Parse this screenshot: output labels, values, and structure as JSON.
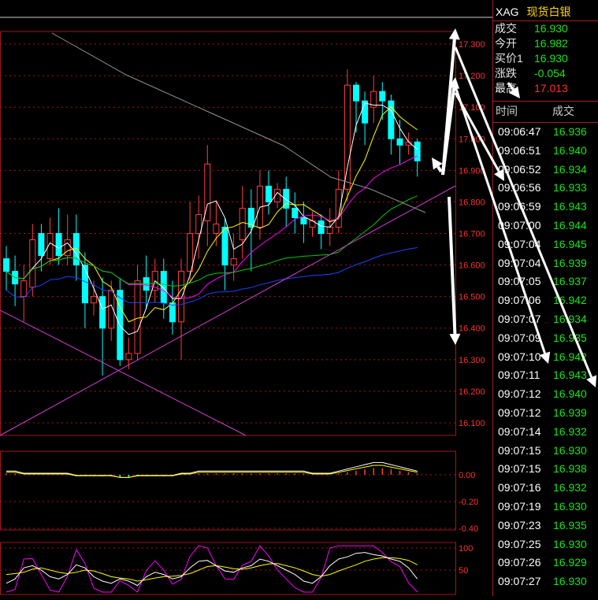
{
  "symbol": {
    "code": "XAG",
    "name": "现货白银"
  },
  "quote": [
    {
      "label": "成交",
      "value": "16.930",
      "color": "green"
    },
    {
      "label": "今开",
      "value": "16.982",
      "color": "green"
    },
    {
      "label": "买价1",
      "value": "16.930",
      "color": "green"
    },
    {
      "label": "涨跌",
      "value": "-0.054",
      "color": "green"
    },
    {
      "label": "最高",
      "value": "17.013",
      "color": "red"
    }
  ],
  "ticks_header": {
    "time": "时间",
    "price": "成交"
  },
  "ticks": [
    {
      "time": "09:06:47",
      "price": "16.936"
    },
    {
      "time": "09:06:51",
      "price": "16.940"
    },
    {
      "time": "09:06:52",
      "price": "16.934"
    },
    {
      "time": "09:06:56",
      "price": "16.933"
    },
    {
      "time": "09:06:59",
      "price": "16.943"
    },
    {
      "time": "09:07:00",
      "price": "16.944"
    },
    {
      "time": "09:07:04",
      "price": "16.945"
    },
    {
      "time": "09:07:04",
      "price": "16.939"
    },
    {
      "time": "09:07:05",
      "price": "16.937"
    },
    {
      "time": "09:07:06",
      "price": "16.942"
    },
    {
      "time": "09:07:07",
      "price": "16.934"
    },
    {
      "time": "09:07:09",
      "price": "16.935"
    },
    {
      "time": "09:07:10",
      "price": "16.942"
    },
    {
      "time": "09:07:11",
      "price": "16.943"
    },
    {
      "time": "09:07:12",
      "price": "16.940"
    },
    {
      "time": "09:07:12",
      "price": "16.939"
    },
    {
      "time": "09:07:14",
      "price": "16.932"
    },
    {
      "time": "09:07:15",
      "price": "16.930"
    },
    {
      "time": "09:07:15",
      "price": "16.938"
    },
    {
      "time": "09:07:16",
      "price": "16.932"
    },
    {
      "time": "09:07:19",
      "price": "16.930"
    },
    {
      "time": "09:07:23",
      "price": "16.935"
    },
    {
      "time": "09:07:25",
      "price": "16.930"
    },
    {
      "time": "09:07:26",
      "price": "16.929"
    },
    {
      "time": "09:07:27",
      "price": "16.930"
    }
  ],
  "colors": {
    "up": "#ff3c3c",
    "down": "#00ffff",
    "grid": "#a01818",
    "ma5": "#ffffff",
    "ma10": "#ffff00",
    "ma20": "#ff00ff",
    "ma60": "#00cc00",
    "ma120": "#2040ff",
    "ma250": "#909090",
    "trendline": "#d040d0"
  },
  "chart_data": [
    {
      "type": "candlestick",
      "price_axis_labels": [
        "17.300",
        "17.200",
        "17.100",
        "17.000",
        "16.900",
        "16.800",
        "16.700",
        "16.600",
        "16.500",
        "16.400",
        "16.300",
        "16.200",
        "16.100"
      ],
      "ylim": [
        16.06,
        17.34
      ],
      "candles": [
        [
          16.62,
          16.58,
          16.66,
          16.52
        ],
        [
          16.58,
          16.54,
          16.63,
          16.47
        ],
        [
          16.5,
          16.55,
          16.6,
          16.42
        ],
        [
          16.53,
          16.68,
          16.73,
          16.5
        ],
        [
          16.7,
          16.63,
          16.73,
          16.58
        ],
        [
          16.62,
          16.7,
          16.75,
          16.6
        ],
        [
          16.7,
          16.63,
          16.78,
          16.6
        ],
        [
          16.63,
          16.68,
          16.76,
          16.6
        ],
        [
          16.7,
          16.6,
          16.76,
          16.55
        ],
        [
          16.6,
          16.48,
          16.64,
          16.4
        ],
        [
          16.48,
          16.5,
          16.55,
          16.44
        ],
        [
          16.5,
          16.4,
          16.56,
          16.25
        ],
        [
          16.4,
          16.52,
          16.55,
          16.36
        ],
        [
          16.52,
          16.3,
          16.56,
          16.28
        ],
        [
          16.3,
          16.32,
          16.37,
          16.27
        ],
        [
          16.32,
          16.55,
          16.6,
          16.3
        ],
        [
          16.56,
          16.52,
          16.63,
          16.46
        ],
        [
          16.52,
          16.58,
          16.62,
          16.48
        ],
        [
          16.58,
          16.48,
          16.62,
          16.43
        ],
        [
          16.48,
          16.42,
          16.55,
          16.38
        ],
        [
          16.42,
          16.58,
          16.62,
          16.3
        ],
        [
          16.58,
          16.7,
          16.8,
          16.55
        ],
        [
          16.7,
          16.76,
          16.82,
          16.62
        ],
        [
          16.74,
          16.92,
          16.98,
          16.66
        ],
        [
          16.7,
          16.73,
          16.8,
          16.66
        ],
        [
          16.72,
          16.6,
          16.75,
          16.52
        ],
        [
          16.6,
          16.62,
          16.7,
          16.55
        ],
        [
          16.68,
          16.78,
          16.85,
          16.62
        ],
        [
          16.78,
          16.72,
          16.84,
          16.58
        ],
        [
          16.72,
          16.85,
          16.9,
          16.68
        ],
        [
          16.85,
          16.8,
          16.9,
          16.76
        ],
        [
          16.8,
          16.84,
          16.86,
          16.78
        ],
        [
          16.84,
          16.78,
          16.88,
          16.72
        ],
        [
          16.78,
          16.75,
          16.83,
          16.7
        ],
        [
          16.75,
          16.73,
          16.8,
          16.67
        ],
        [
          16.72,
          16.74,
          16.77,
          16.69
        ],
        [
          16.74,
          16.7,
          16.76,
          16.65
        ],
        [
          16.7,
          16.72,
          16.78,
          16.66
        ],
        [
          16.72,
          16.84,
          16.9,
          16.7
        ],
        [
          16.84,
          17.17,
          17.22,
          16.8
        ],
        [
          17.17,
          17.12,
          17.18,
          17.02
        ],
        [
          17.12,
          17.05,
          17.15,
          16.98
        ],
        [
          17.1,
          17.15,
          17.2,
          17.05
        ],
        [
          17.15,
          17.12,
          17.18,
          17.06
        ],
        [
          17.12,
          17.0,
          17.14,
          16.95
        ],
        [
          17.0,
          16.98,
          17.06,
          16.92
        ],
        [
          16.98,
          16.99,
          17.02,
          16.95
        ],
        [
          16.99,
          16.93,
          17.0,
          16.88
        ]
      ]
    },
    {
      "type": "bar",
      "name": "MACD",
      "axis_labels": [
        "0.00",
        "-0.20",
        "-0.40"
      ],
      "ylim": [
        -0.4,
        0.1
      ],
      "values": [
        0.01,
        0.01,
        0.0,
        0.0,
        0.0,
        0.0,
        0.0,
        0.0,
        -0.01,
        -0.01,
        -0.01,
        -0.01,
        -0.01,
        -0.02,
        -0.02,
        -0.01,
        -0.01,
        -0.01,
        -0.01,
        -0.01,
        0.0,
        0.0,
        0.01,
        0.01,
        0.01,
        0.01,
        0.01,
        0.01,
        0.01,
        0.01,
        0.01,
        0.01,
        0.01,
        0.01,
        0.01,
        0.0,
        0.0,
        0.0,
        0.01,
        0.02,
        0.03,
        0.04,
        0.05,
        0.05,
        0.04,
        0.03,
        0.02,
        0.01
      ]
    },
    {
      "type": "line",
      "name": "KDJ",
      "axis_labels": [
        "100",
        "50"
      ],
      "ylim": [
        0,
        110
      ],
      "k": [
        20,
        30,
        55,
        60,
        50,
        35,
        30,
        40,
        62,
        55,
        35,
        25,
        20,
        30,
        25,
        15,
        35,
        45,
        40,
        30,
        35,
        55,
        70,
        72,
        60,
        48,
        45,
        55,
        60,
        75,
        70,
        60,
        50,
        40,
        25,
        20,
        35,
        60,
        75,
        80,
        88,
        90,
        85,
        82,
        75,
        70,
        55,
        30
      ],
      "d": [
        40,
        42,
        45,
        52,
        55,
        50,
        45,
        42,
        45,
        50,
        48,
        42,
        35,
        32,
        30,
        25,
        28,
        32,
        35,
        36,
        38,
        42,
        50,
        58,
        60,
        57,
        53,
        52,
        55,
        60,
        64,
        65,
        60,
        55,
        48,
        40,
        36,
        40,
        48,
        55,
        62,
        70,
        75,
        78,
        78,
        76,
        72,
        62
      ]
    }
  ]
}
